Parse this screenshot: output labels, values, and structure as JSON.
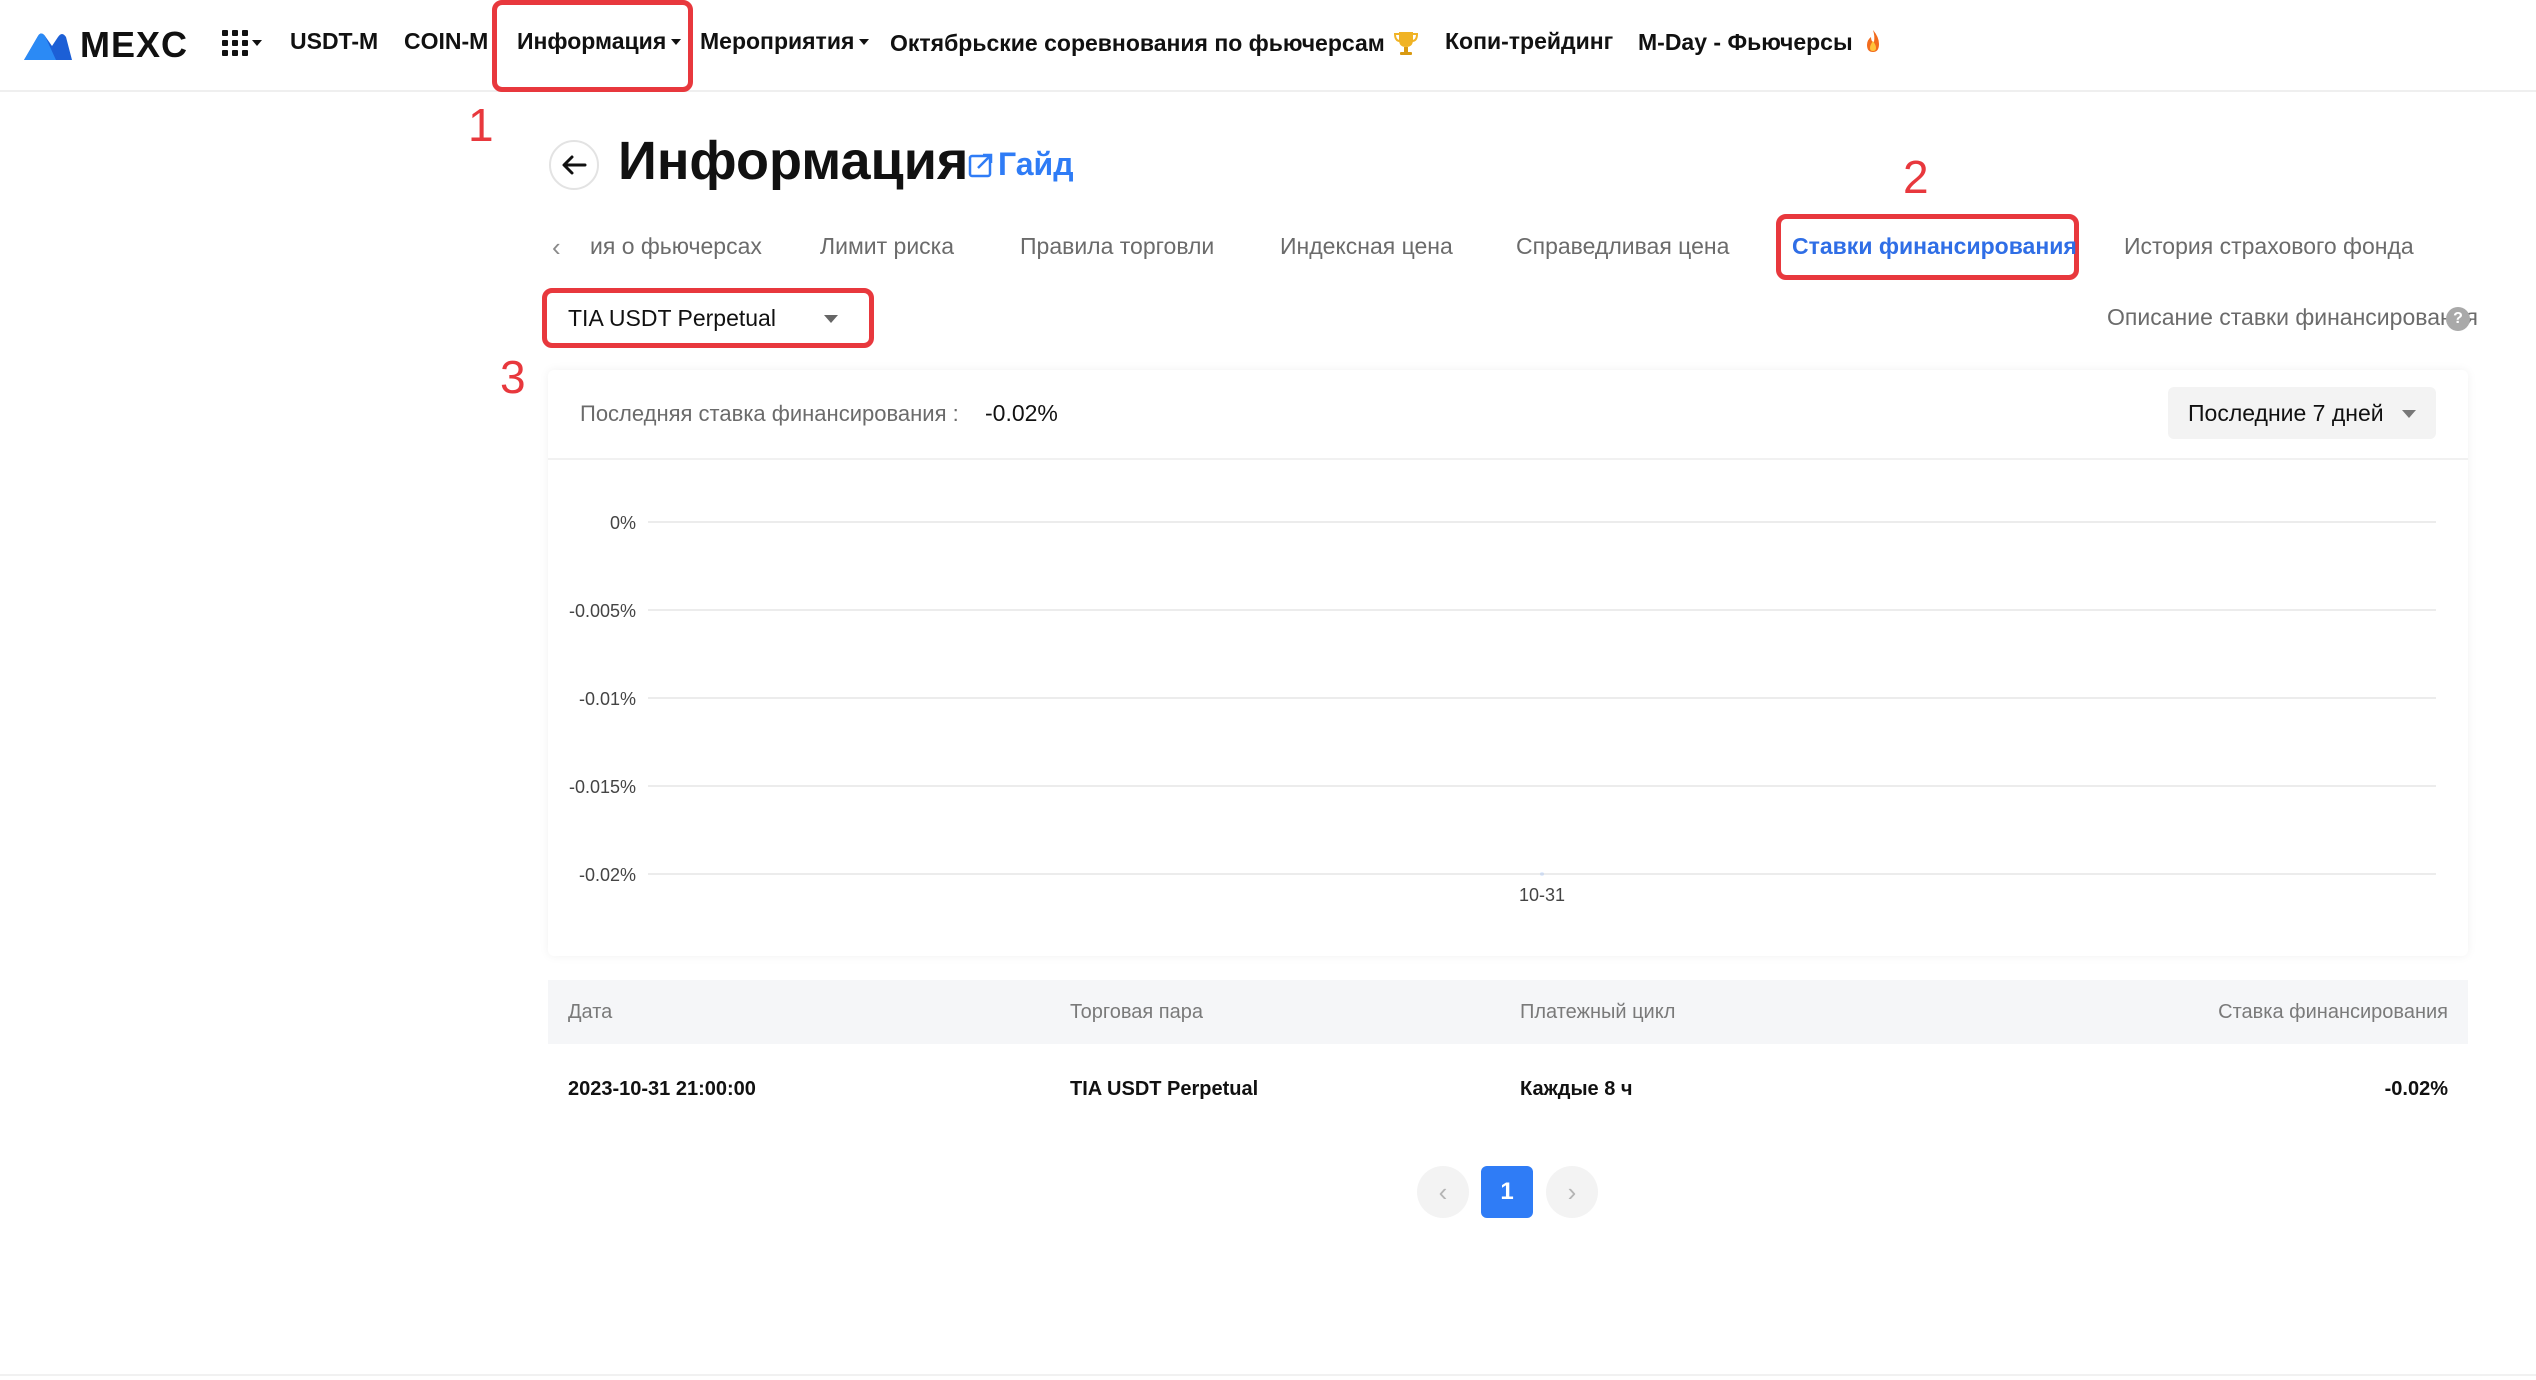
{
  "brand": {
    "name": "MEXC"
  },
  "nav": {
    "usdt_m": "USDT-M",
    "coin_m": "COIN-M",
    "info": "Информация",
    "events": "Мероприятия",
    "october": "Октябрьские соревнования по фьючерсам",
    "copy": "Копи-трейдинг",
    "mday": "M-Day - Фьючерсы"
  },
  "annotations": [
    "1",
    "2",
    "3"
  ],
  "header": {
    "title": "Информация",
    "guide": "Гайд"
  },
  "tabs": [
    "ия о фьючерсах",
    "Лимит риска",
    "Правила торговли",
    "Индексная цена",
    "Справедливая цена",
    "Ставки финансирования",
    "История страхового фонда"
  ],
  "active_tab": "Ставки финансирования",
  "pair_select": {
    "value": "TIA USDT Perpetual"
  },
  "funding_desc": "Описание ставки финансирования",
  "chart_card": {
    "last_rate_label": "Последняя ставка финансирования :",
    "last_rate_value": "-0.02%",
    "range": "Последние 7 дней"
  },
  "chart_data": {
    "type": "line",
    "x": [
      "10-31"
    ],
    "series": [
      {
        "values": [
          -0.02
        ]
      }
    ],
    "ytick_labels": [
      "0%",
      "-0.005%",
      "-0.01%",
      "-0.015%",
      "-0.02%"
    ],
    "yticks": [
      0,
      -0.005,
      -0.01,
      -0.015,
      -0.02
    ],
    "ylim": [
      -0.02,
      0
    ],
    "grid": true
  },
  "table": {
    "headers": [
      "Дата",
      "Торговая пара",
      "Платежный цикл",
      "Ставка финансирования"
    ],
    "rows": [
      [
        "2023-10-31 21:00:00",
        "TIA USDT Perpetual",
        "Каждые 8 ч",
        "-0.02%"
      ]
    ]
  },
  "pagination": {
    "prev": "‹",
    "current": "1",
    "next": "›"
  },
  "colors": {
    "accent": "#2f7cf6",
    "annotation": "#e8383d"
  }
}
